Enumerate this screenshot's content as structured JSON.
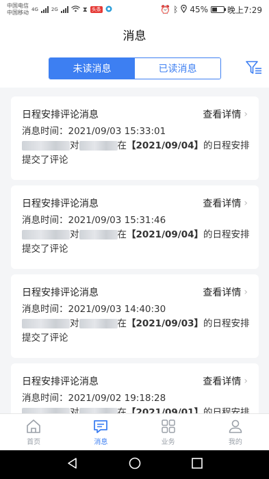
{
  "status_bar": {
    "carrier_1": "中国电信",
    "carrier_2": "中国移动",
    "net_1": "4G",
    "net_2": "2G",
    "badge": "头条",
    "battery": "45%",
    "battery_level": 0.45,
    "time": "晚上7:29"
  },
  "header": {
    "title": "消息",
    "tabs": [
      {
        "label": "未读消息",
        "active": true
      },
      {
        "label": "已读消息",
        "active": false
      }
    ]
  },
  "messages": [
    {
      "title": "日程安排评论消息",
      "detail_label": "查看详情",
      "time": "消息时间：2021/09/03 15:33:01",
      "connector": "对",
      "in": "在",
      "date": "【2021/09/04】",
      "tail": "的日程安排",
      "line2": "提交了评论"
    },
    {
      "title": "日程安排评论消息",
      "detail_label": "查看详情",
      "time": "消息时间：2021/09/03 15:31:46",
      "connector": "对",
      "in": "在",
      "date": "【2021/09/04】",
      "tail": "的日程安排",
      "line2": "提交了评论"
    },
    {
      "title": "日程安排评论消息",
      "detail_label": "查看详情",
      "time": "消息时间：2021/09/03 14:40:30",
      "connector": "对",
      "in": "在",
      "date": "【2021/09/03】",
      "tail": "的日程安排",
      "line2": "提交了评论"
    },
    {
      "title": "日程安排评论消息",
      "detail_label": "查看详情",
      "time": "消息时间：2021/09/02 19:18:28",
      "connector": "对",
      "in": "在",
      "date": "【2021/09/01】",
      "tail": "的日程安排",
      "line2": ""
    }
  ],
  "tabbar": {
    "items": [
      {
        "label": "首页",
        "icon": "home-icon",
        "active": false
      },
      {
        "label": "消息",
        "icon": "message-icon",
        "active": true
      },
      {
        "label": "业务",
        "icon": "grid-icon",
        "active": false
      },
      {
        "label": "我的",
        "icon": "user-icon",
        "active": false
      }
    ]
  },
  "colors": {
    "accent": "#3d7ff2",
    "inactive": "#9aa0a8",
    "background": "#f4f5f7"
  }
}
